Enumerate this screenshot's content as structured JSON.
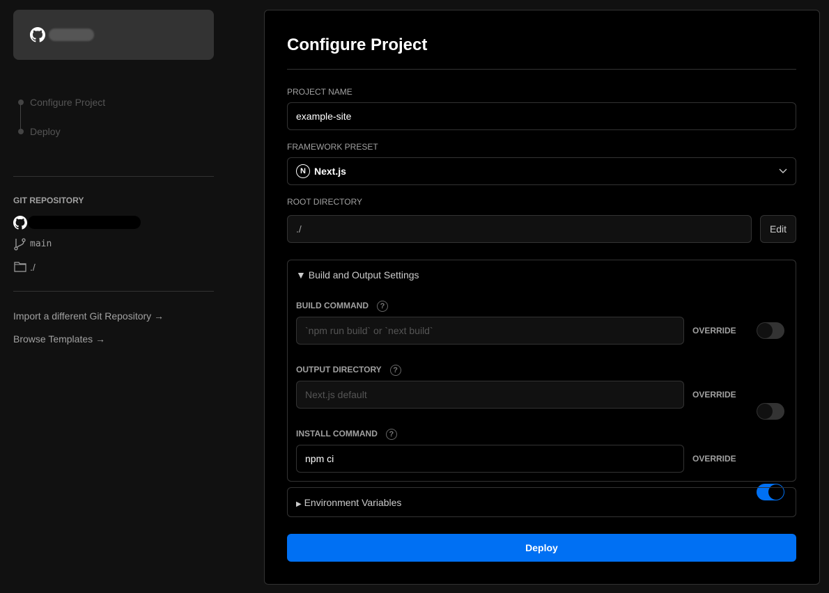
{
  "sidebar": {
    "steps": [
      {
        "label": "Configure Project"
      },
      {
        "label": "Deploy"
      }
    ],
    "git_repository_label": "GIT REPOSITORY",
    "branch": "main",
    "root": "./",
    "links": [
      {
        "label": "Import a different Git Repository →"
      },
      {
        "label": "Browse Templates →"
      }
    ]
  },
  "main": {
    "title": "Configure Project",
    "project_name": {
      "label": "PROJECT NAME",
      "value": "example-site"
    },
    "framework": {
      "label": "FRAMEWORK PRESET",
      "value": "Next.js"
    },
    "root_directory": {
      "label": "ROOT DIRECTORY",
      "value": "./",
      "edit_label": "Edit"
    },
    "build_settings": {
      "title": "Build and Output Settings",
      "expanded": true,
      "fields": [
        {
          "label": "BUILD COMMAND",
          "placeholder": "`npm run build` or `next build`",
          "value": "",
          "override_label": "OVERRIDE",
          "override": false
        },
        {
          "label": "OUTPUT DIRECTORY",
          "placeholder": "Next.js default",
          "value": "",
          "override_label": "OVERRIDE",
          "override": false
        },
        {
          "label": "INSTALL COMMAND",
          "placeholder": "",
          "value": "npm ci",
          "override_label": "OVERRIDE",
          "override": true
        }
      ]
    },
    "env_vars": {
      "title": "Environment Variables",
      "expanded": false
    },
    "deploy_label": "Deploy"
  },
  "colors": {
    "accent": "#0070f3",
    "background": "#111111",
    "panel": "#000000"
  }
}
